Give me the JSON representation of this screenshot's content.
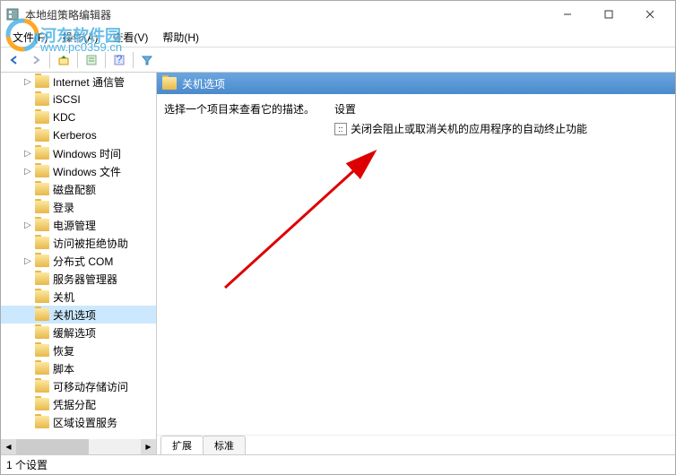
{
  "window": {
    "title": "本地组策略编辑器"
  },
  "menu": {
    "file": "文件(F)",
    "action": "操作(A)",
    "view": "查看(V)",
    "help": "帮助(H)"
  },
  "tree": {
    "items": [
      {
        "label": "Internet 通信管",
        "expand": "▷"
      },
      {
        "label": "iSCSI",
        "expand": ""
      },
      {
        "label": "KDC",
        "expand": ""
      },
      {
        "label": "Kerberos",
        "expand": ""
      },
      {
        "label": "Windows 时间",
        "expand": "▷"
      },
      {
        "label": "Windows 文件",
        "expand": "▷"
      },
      {
        "label": "磁盘配额",
        "expand": ""
      },
      {
        "label": "登录",
        "expand": ""
      },
      {
        "label": "电源管理",
        "expand": "▷"
      },
      {
        "label": "访问被拒绝协助",
        "expand": ""
      },
      {
        "label": "分布式 COM",
        "expand": "▷"
      },
      {
        "label": "服务器管理器",
        "expand": ""
      },
      {
        "label": "关机",
        "expand": ""
      },
      {
        "label": "关机选项",
        "expand": "",
        "selected": true
      },
      {
        "label": "缓解选项",
        "expand": ""
      },
      {
        "label": "恢复",
        "expand": ""
      },
      {
        "label": "脚本",
        "expand": ""
      },
      {
        "label": "可移动存储访问",
        "expand": ""
      },
      {
        "label": "凭据分配",
        "expand": ""
      },
      {
        "label": "区域设置服务",
        "expand": ""
      }
    ]
  },
  "detail": {
    "header": "关机选项",
    "description": "选择一个项目来查看它的描述。",
    "settingsHeader": "设置",
    "settings": [
      {
        "label": "关闭会阻止或取消关机的应用程序的自动终止功能"
      }
    ]
  },
  "tabs": {
    "extended": "扩展",
    "standard": "标准"
  },
  "status": "1 个设置",
  "watermark": {
    "text": "河东软件园",
    "url": "www.pc0359.cn"
  }
}
